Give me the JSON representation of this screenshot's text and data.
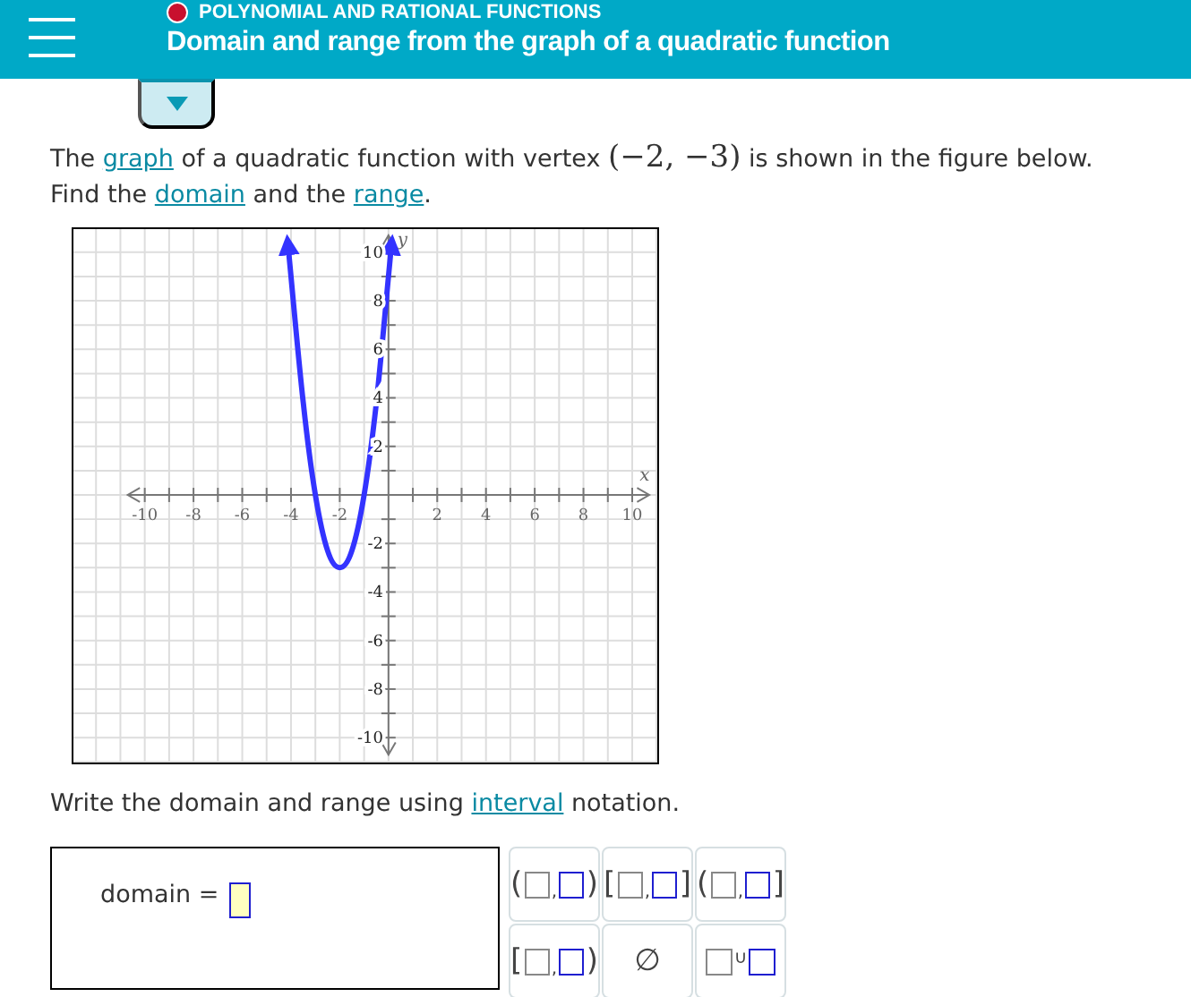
{
  "header": {
    "topic": "POLYNOMIAL AND RATIONAL FUNCTIONS",
    "title": "Domain and range from the graph of a quadratic function"
  },
  "question": [
    {
      "kind": "plain",
      "text": "The "
    },
    {
      "kind": "link",
      "text": "graph"
    },
    {
      "kind": "plain",
      "text": " of a quadratic function with vertex "
    },
    {
      "kind": "math",
      "text": "(−2, −3)"
    },
    {
      "kind": "plain",
      "text": " is shown in the figure below."
    },
    {
      "kind": "break",
      "text": "Find the "
    },
    {
      "kind": "link",
      "text": "domain"
    },
    {
      "kind": "plain",
      "text": " and the "
    },
    {
      "kind": "link",
      "text": "range"
    },
    {
      "kind": "plain",
      "text": "."
    }
  ],
  "graph": {
    "chart_data": {
      "type": "line",
      "xlabel": "x",
      "ylabel": "y",
      "x": [
        -4,
        -3.5,
        -3,
        -2.5,
        -2,
        -1.5,
        -1,
        -0.5,
        0
      ],
      "series": [
        {
          "color": "#3333ff",
          "values": [
            9,
            3.8,
            0,
            -2.3,
            -3,
            -2.3,
            0,
            3.8,
            9
          ]
        }
      ],
      "grid": true,
      "xlim": [
        -10,
        10
      ],
      "ylim": [
        -10,
        10
      ],
      "xticks": [
        -10,
        -8,
        -6,
        -4,
        -2,
        2,
        4,
        6,
        8,
        10
      ],
      "yticks": [
        -10,
        -8,
        -6,
        -4,
        -2,
        2,
        4,
        6,
        8,
        10
      ]
    }
  },
  "instruction": [
    {
      "kind": "plain",
      "text": "Write the domain and range using "
    },
    {
      "kind": "link",
      "text": "interval"
    },
    {
      "kind": "plain",
      "text": " notation."
    }
  ],
  "answer": {
    "label": "domain ="
  },
  "palette": [
    {
      "kind": "interval",
      "left": "(",
      "separator": ",",
      "right": ")"
    },
    {
      "kind": "interval",
      "left": "[",
      "separator": ",",
      "right": "]"
    },
    {
      "kind": "interval",
      "left": "(",
      "separator": ",",
      "right": "]"
    },
    {
      "kind": "interval",
      "left": "[",
      "separator": ",",
      "right": ")"
    },
    {
      "kind": "symbol",
      "symbol": "∅"
    },
    {
      "kind": "union",
      "symbol": "∪"
    }
  ]
}
